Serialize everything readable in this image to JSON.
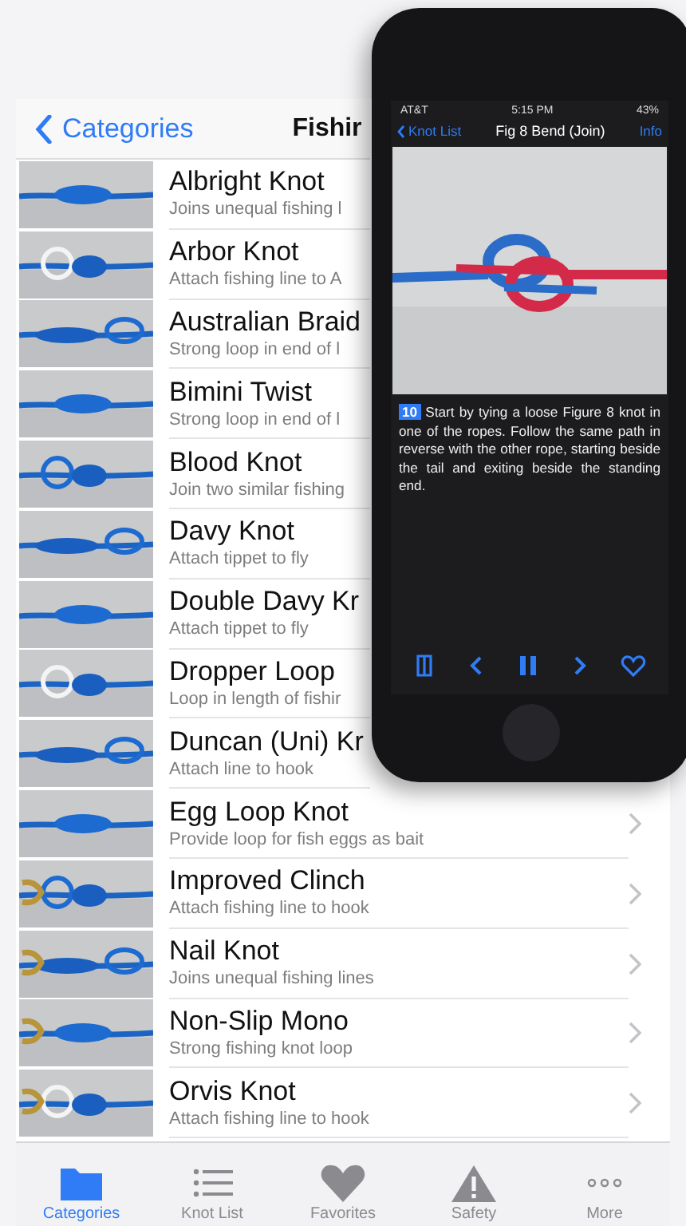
{
  "list_screen": {
    "back_label": "Categories",
    "title": "Fishir",
    "rows": [
      {
        "title": "Albright Knot",
        "subtitle": "Joins unequal fishing l",
        "chevron": false
      },
      {
        "title": "Arbor Knot",
        "subtitle": "Attach fishing line to A",
        "chevron": false
      },
      {
        "title": "Australian Braid",
        "subtitle": "Strong loop in end of l",
        "chevron": false
      },
      {
        "title": "Bimini Twist",
        "subtitle": "Strong loop in end of l",
        "chevron": false
      },
      {
        "title": "Blood Knot",
        "subtitle": "Join two similar fishing",
        "chevron": false
      },
      {
        "title": "Davy Knot",
        "subtitle": "Attach tippet to fly",
        "chevron": false
      },
      {
        "title": "Double Davy Kr",
        "subtitle": "Attach tippet to fly",
        "chevron": false
      },
      {
        "title": "Dropper Loop",
        "subtitle": "Loop in length of fishir",
        "chevron": false
      },
      {
        "title": "Duncan (Uni) Kr",
        "subtitle": "Attach line to hook",
        "chevron": false
      },
      {
        "title": "Egg Loop Knot",
        "subtitle": "Provide loop for fish eggs as bait",
        "chevron": true
      },
      {
        "title": "Improved Clinch",
        "subtitle": "Attach fishing line to hook",
        "chevron": true
      },
      {
        "title": "Nail Knot",
        "subtitle": "Joins unequal fishing lines",
        "chevron": true
      },
      {
        "title": "Non-Slip Mono",
        "subtitle": "Strong fishing knot loop",
        "chevron": true
      },
      {
        "title": "Orvis Knot",
        "subtitle": "Attach fishing line to hook",
        "chevron": true
      }
    ],
    "tabs": [
      {
        "kind": "folder",
        "label": "Categories",
        "selected": true
      },
      {
        "kind": "list",
        "label": "Knot List",
        "selected": false
      },
      {
        "kind": "heart",
        "label": "Favorites",
        "selected": false
      },
      {
        "kind": "warning",
        "label": "Safety",
        "selected": false
      },
      {
        "kind": "more",
        "label": "More",
        "selected": false
      }
    ]
  },
  "phone": {
    "carrier": "AT&T",
    "time": "5:15 PM",
    "battery": "43%",
    "back_label": "Knot List",
    "title": "Fig 8 Bend (Join)",
    "action": "Info",
    "step": "10",
    "text": "Start by tying a loose Figure 8 knot in one of the ropes. Follow the same path in reverse with the other rope, starting beside the tail and exiting beside the standing end.",
    "controls": [
      {
        "kind": "book"
      },
      {
        "kind": "prev"
      },
      {
        "kind": "pause"
      },
      {
        "kind": "next"
      },
      {
        "kind": "heart"
      }
    ]
  }
}
